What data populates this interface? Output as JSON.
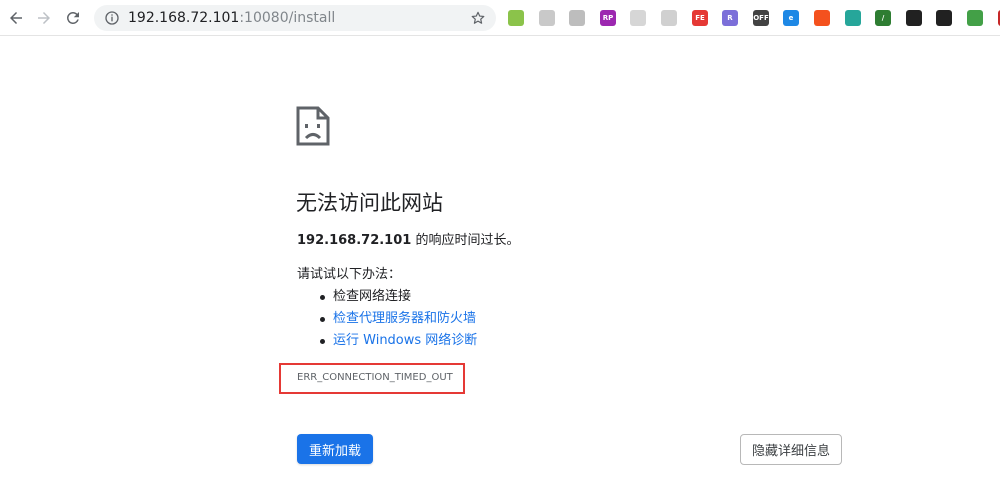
{
  "toolbar": {
    "url_host": "192.168.72.101",
    "url_path": ":10080/install",
    "extensions": [
      {
        "name": "ext-green-circle",
        "color": "#8bc34a",
        "label": ""
      },
      {
        "name": "ext-gray-page",
        "color": "#c9c9c9",
        "label": ""
      },
      {
        "name": "ext-tree",
        "color": "#bdbdbd",
        "label": ""
      },
      {
        "name": "ext-rp",
        "color": "#9c27b0",
        "label": "RP"
      },
      {
        "name": "ext-mail",
        "color": "#d6d6d6",
        "label": ""
      },
      {
        "name": "ext-grid",
        "color": "#d0d0d0",
        "label": ""
      },
      {
        "name": "ext-fe",
        "color": "#e53935",
        "label": "FE"
      },
      {
        "name": "ext-r-hex",
        "color": "#7c6fd9",
        "label": "R"
      },
      {
        "name": "ext-off",
        "color": "#424242",
        "label": "OFF"
      },
      {
        "name": "ext-blue-e",
        "color": "#1e88e5",
        "label": "e"
      },
      {
        "name": "ext-orange",
        "color": "#f4511e",
        "label": ""
      },
      {
        "name": "ext-teal-flower",
        "color": "#26a69a",
        "label": ""
      },
      {
        "name": "ext-pen",
        "color": "#2e7d32",
        "label": "/"
      },
      {
        "name": "ext-shield",
        "color": "#212121",
        "label": ""
      },
      {
        "name": "ext-tamper",
        "color": "#212121",
        "label": ""
      },
      {
        "name": "ext-download",
        "color": "#43a047",
        "label": ""
      },
      {
        "name": "ext-video",
        "color": "#c62828",
        "label": ""
      }
    ]
  },
  "page": {
    "title": "无法访问此网站",
    "desc_host": "192.168.72.101",
    "desc_suffix": " 的响应时间过长。",
    "suggest_title": "请试试以下办法：",
    "suggestions": [
      {
        "text": "检查网络连接",
        "link": false
      },
      {
        "text": "检查代理服务器和防火墙",
        "link": true
      },
      {
        "text": "运行 Windows 网络诊断",
        "link": true
      }
    ],
    "error_code": "ERR_CONNECTION_TIMED_OUT",
    "reload_label": "重新加载",
    "details_label": "隐藏详细信息"
  },
  "colors": {
    "accent": "#1a73e8",
    "highlight_box": "#e53935"
  }
}
